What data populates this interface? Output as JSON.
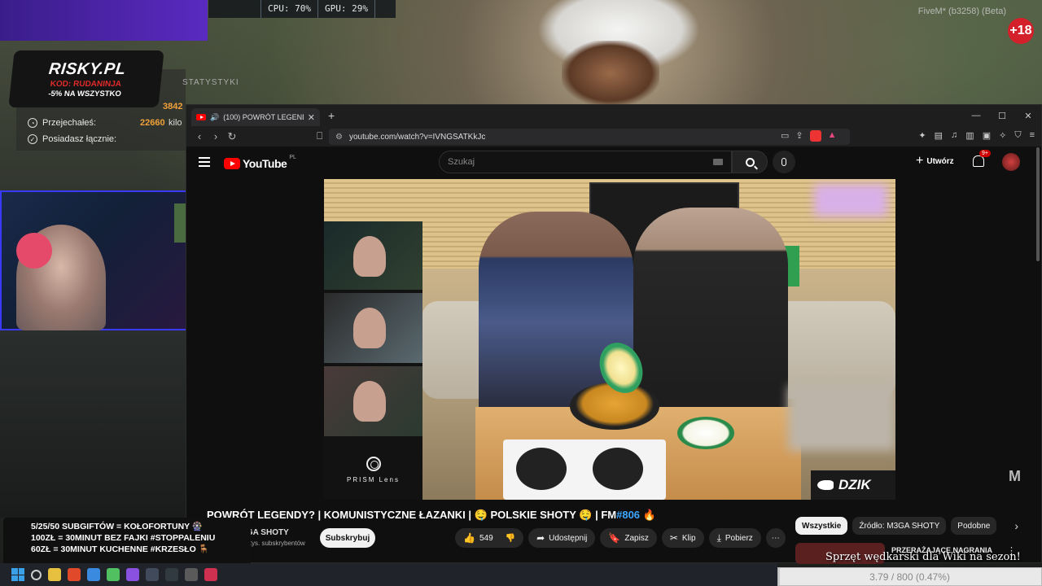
{
  "game": {
    "perf": {
      "cpu": "CPU: 70%",
      "gpu": "GPU: 29%"
    },
    "title": "FiveM* (b3258) (Beta)",
    "age_badge": "+18",
    "sponsor": {
      "logo": "RISKY.PL",
      "code": "KOD: RUDANINJA",
      "promo": "-5% NA WSZYSTKO"
    },
    "stats": {
      "title": "STATYSTYKI",
      "rows": [
        {
          "label": "Przejechałeś:",
          "value": "22660",
          "unit": "kilo"
        },
        {
          "label": "Posiadasz łącznie:",
          "value": "",
          "unit": ""
        }
      ],
      "partial_value": "3842"
    },
    "sub_goals": [
      "5/25/50 SUBGIFTÓW = KOŁOFORTUNY 🎡",
      "100ZŁ = 30MINUT BEZ FAJKI #STOPPALENIU",
      "60ZŁ = 30MINUT KUCHENNE #KRZESŁO 🪑"
    ]
  },
  "browser": {
    "tab_title": "(100) POWRÓT LEGENDY? | K",
    "url": "youtube.com/watch?v=IVNGSATKkJc",
    "window_controls": [
      "—",
      "☐",
      "✕"
    ]
  },
  "youtube": {
    "logo_text": "YouTube",
    "region": "PL",
    "search_placeholder": "Szukaj",
    "create_label": "Utwórz",
    "notif_count": "9+",
    "video": {
      "title": "POWRÓT LEGENDY? | KOMUNISTYCZNE ŁAZANKI | 🤤 POLSKIE SHOTY 🤤 | FM",
      "tag": "#806",
      "title_suffix": " 🔥",
      "prism_label": "PRISM Lens",
      "brand": "DZIK"
    },
    "channel": {
      "name": "M3GA SHOTY",
      "subs": "69,9 tys. subskrybentów",
      "subscribe": "Subskrybuj"
    },
    "actions": {
      "likes": "549",
      "share": "Udostępnij",
      "save": "Zapisz",
      "clip": "Klip",
      "download": "Pobierz"
    },
    "chips": [
      "Wszystkie",
      "Źródło: M3GA SHOTY",
      "Podobne"
    ],
    "recommended_title": "PRZERAŻAJĄCE NAGRANIA"
  },
  "donation": {
    "message": "Sprzęt wędkarski dla Wiki na sezon!",
    "progress_label": "3.79 / 800 (0.47%)",
    "progress_fraction": 0.0047
  }
}
